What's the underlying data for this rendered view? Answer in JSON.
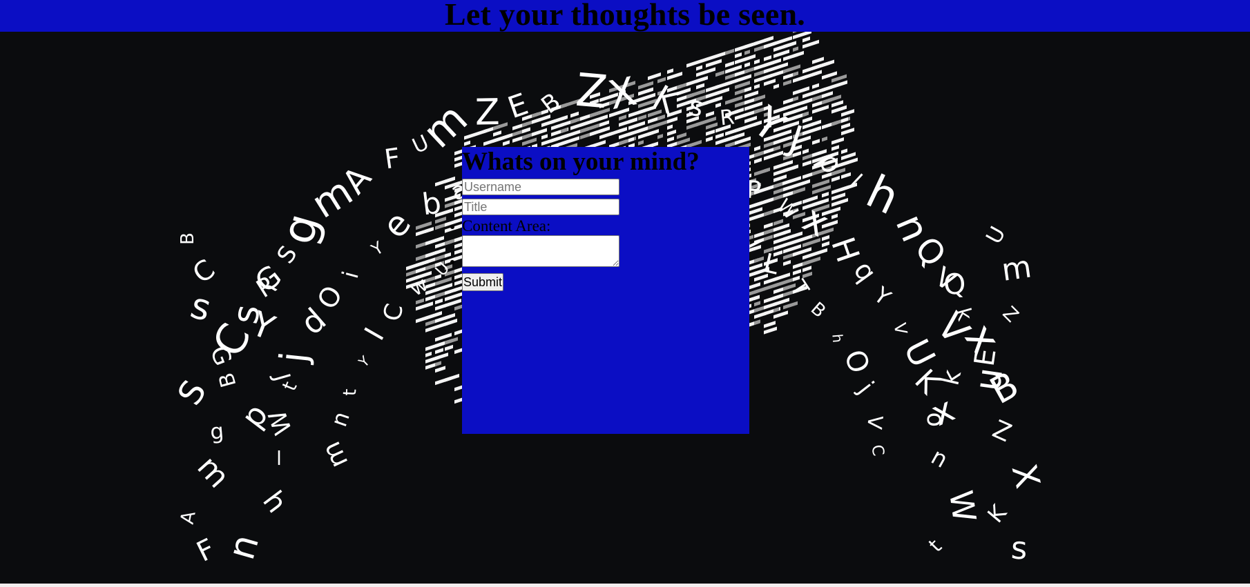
{
  "header": {
    "title": "Let your thoughts be seen."
  },
  "form": {
    "heading": "Whats on your mind?",
    "username_placeholder": "Username",
    "title_placeholder": "Title",
    "content_label": "Content Area:",
    "submit_label": "Submit"
  },
  "background": {
    "letters": [
      "B",
      "C",
      "s",
      "G",
      "S",
      "g",
      "m",
      "A",
      "F",
      "U",
      "m",
      "Z",
      "E",
      "B",
      "Z",
      "X",
      "K",
      "s",
      "R",
      "Y",
      "J",
      "p",
      "l",
      "h",
      "n",
      "Q",
      "V",
      "k",
      "x",
      "n",
      "W",
      "t",
      "j",
      "d",
      "O",
      "i",
      "Y",
      "e",
      "b",
      "a",
      "Z",
      "D",
      "Q",
      "o",
      "k",
      "G",
      "L",
      "J",
      "P",
      "W",
      "x",
      "H",
      "q",
      "Y",
      "V",
      "U",
      "K",
      "o",
      "m",
      "n",
      "t",
      "Y",
      "I",
      "C",
      "w",
      "U",
      "A",
      "R",
      "m",
      "H",
      "o",
      "j",
      "R",
      "S",
      "e",
      "Y",
      "L",
      "T",
      "B",
      "h",
      "O",
      "j",
      "V",
      "C"
    ],
    "colors": {
      "backdrop": "#0b0c0e",
      "letters": "#ffffff",
      "header": "#0b0ec4",
      "panel": "#0b0ec4"
    }
  }
}
